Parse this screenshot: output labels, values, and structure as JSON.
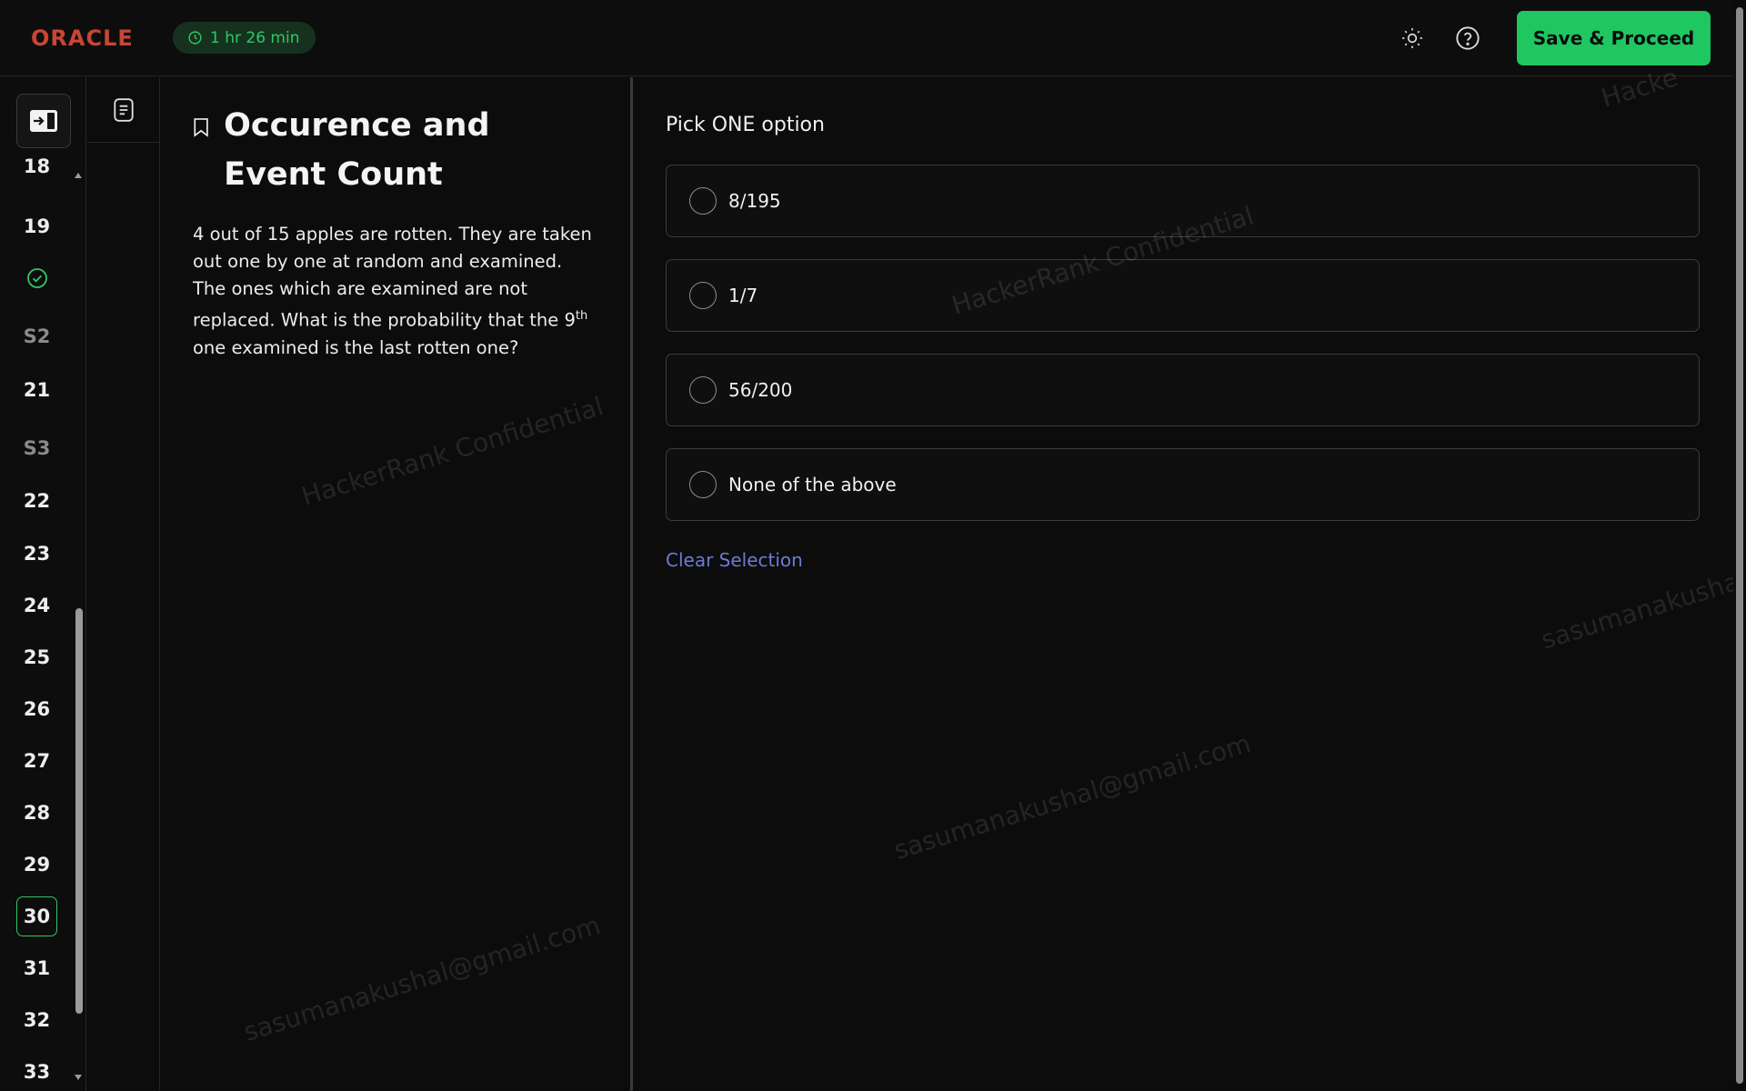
{
  "header": {
    "logo": "ORACLE",
    "timer": "1 hr 26 min",
    "save_label": "Save & Proceed",
    "theme_icon": "sun-icon",
    "help_icon": "help-circle-icon"
  },
  "nav": {
    "items": [
      {
        "label": "18",
        "kind": "question"
      },
      {
        "label": "19",
        "kind": "question"
      },
      {
        "label": "",
        "kind": "answered",
        "icon": "check-circle-icon"
      },
      {
        "label": "S2",
        "kind": "section"
      },
      {
        "label": "21",
        "kind": "question"
      },
      {
        "label": "S3",
        "kind": "section"
      },
      {
        "label": "22",
        "kind": "question"
      },
      {
        "label": "23",
        "kind": "question"
      },
      {
        "label": "24",
        "kind": "question"
      },
      {
        "label": "25",
        "kind": "question"
      },
      {
        "label": "26",
        "kind": "question"
      },
      {
        "label": "27",
        "kind": "question"
      },
      {
        "label": "28",
        "kind": "question"
      },
      {
        "label": "29",
        "kind": "question"
      },
      {
        "label": "30",
        "kind": "current"
      },
      {
        "label": "31",
        "kind": "question"
      },
      {
        "label": "32",
        "kind": "question"
      },
      {
        "label": "33",
        "kind": "question"
      }
    ]
  },
  "question": {
    "title": "Occurence and Event Count",
    "body_before": "4 out of 15 apples are rotten. They are taken out one by one at random and examined. The ones which are examined are not replaced. What is the probability that the 9",
    "body_sup": "th",
    "body_after": " one examined is the last rotten one?"
  },
  "answers": {
    "prompt": "Pick ONE option",
    "options": [
      "8/195",
      "1/7",
      "56/200",
      "None of the above"
    ],
    "clear_label": "Clear Selection"
  },
  "watermarks": {
    "confidential": "HackerRank Confidential",
    "email": "sasumanakushal@gmail.com",
    "partial": "Hacke",
    "email_partial": "sasumanakushal@"
  },
  "colors": {
    "accent_green": "#1ec760",
    "logo_red": "#c74634",
    "link_blue": "#6b7bd6",
    "background": "#0c0c0c"
  }
}
